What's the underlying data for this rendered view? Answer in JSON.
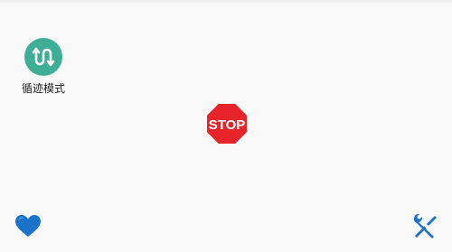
{
  "mode": {
    "label": "循迹模式",
    "icon": "loop-arrows-icon",
    "color": "#3fae96"
  },
  "stop": {
    "label": "STOP",
    "icon": "stop-sign-icon",
    "color": "#e8242b"
  },
  "favorite": {
    "icon": "heart-icon",
    "color": "#1a73c9"
  },
  "tools": {
    "icon": "tools-icon",
    "color": "#1a73c9"
  }
}
